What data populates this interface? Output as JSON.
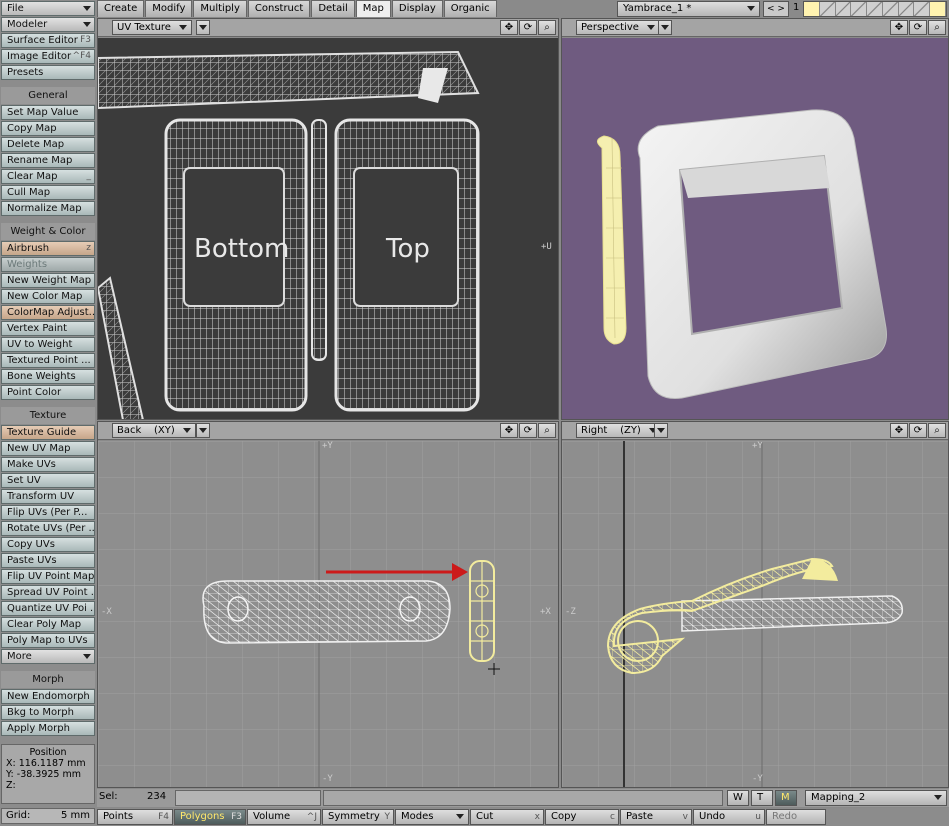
{
  "sidebar": {
    "file_menu": "File",
    "modeler_menu": "Modeler",
    "tools": [
      {
        "label": "Surface Editor",
        "key": "F3"
      },
      {
        "label": "Image Editor",
        "key": "^F4"
      },
      {
        "label": "Presets",
        "key": ""
      }
    ],
    "general_header": "General",
    "general_items": [
      "Set Map Value",
      "Copy Map",
      "Delete Map",
      "Rename Map",
      "Clear Map",
      "Cull Map",
      "Normalize Map"
    ],
    "clear_map_key": "_",
    "weight_header": "Weight & Color",
    "airbrush_label": "Airbrush",
    "airbrush_key": "z",
    "weights_label": "Weights",
    "weight_items": [
      "New Weight Map",
      "New Color Map",
      "ColorMap Adjust...",
      "Vertex Paint",
      "UV to Weight",
      "Textured Point ...",
      "Bone Weights",
      "Point Color"
    ],
    "texture_header": "Texture",
    "texture_guide_label": "Texture Guide",
    "texture_items": [
      "New UV Map",
      "Make UVs",
      "Set UV",
      "Transform UV",
      "Flip UVs (Per P...",
      "Rotate UVs (Per ...",
      "Copy UVs",
      "Paste UVs",
      "Flip UV Point Map",
      "Spread UV Point ...",
      "Quantize UV Poi ...",
      "Clear Poly Map",
      "Poly Map to UVs"
    ],
    "more_label": "More",
    "morph_header": "Morph",
    "morph_items": [
      "New Endomorph",
      "Bkg to Morph",
      "Apply Morph"
    ],
    "position": {
      "title": "Position",
      "x": "X:  116.1187 mm",
      "y": "Y:  -38.3925 mm",
      "z": "Z:"
    },
    "grid_label": "Grid:",
    "grid_value": "5 mm"
  },
  "tabs": [
    "Create",
    "Modify",
    "Multiply",
    "Construct",
    "Detail",
    "Map",
    "Display",
    "Organic"
  ],
  "active_tab": "Map",
  "object_name": "Yambrace_1  *",
  "layer_nav": "< >",
  "layer_number": "1",
  "viewports": {
    "uv": {
      "mode": "UV Texture",
      "label_bottom": "Bottom",
      "label_top": "Top",
      "axis_u": "+U"
    },
    "perspective": {
      "mode": "Perspective",
      "bg_color": "#6f5b80"
    },
    "back": {
      "mode": "Back",
      "axes": "(XY)",
      "plus_y": "+Y",
      "minus_y": "-Y",
      "minus_x": "-X",
      "plus_x": "+X"
    },
    "right": {
      "mode": "Right",
      "axes": "(ZY)",
      "plus_y": "+Y",
      "minus_y": "-Y",
      "minus_z": "-Z",
      "plus_z": "+Z"
    }
  },
  "status": {
    "sel_label": "Sel:",
    "sel_value": "234",
    "w": "W",
    "t": "T",
    "m": "M",
    "mapping": "Mapping_2"
  },
  "bottom": {
    "points": "Points",
    "points_key": "F4",
    "polygons": "Polygons",
    "polygons_key": "F3",
    "volume": "Volume",
    "volume_key": "^J",
    "symmetry": "Symmetry",
    "symmetry_key": "Y",
    "modes": "Modes",
    "cut": "Cut",
    "cut_key": "x",
    "copy": "Copy",
    "copy_key": "c",
    "paste": "Paste",
    "paste_key": "v",
    "undo": "Undo",
    "undo_key": "u",
    "redo": "Redo"
  },
  "colors": {
    "accent_arrow": "#d01818",
    "selected_wire": "#f0eaa0"
  }
}
